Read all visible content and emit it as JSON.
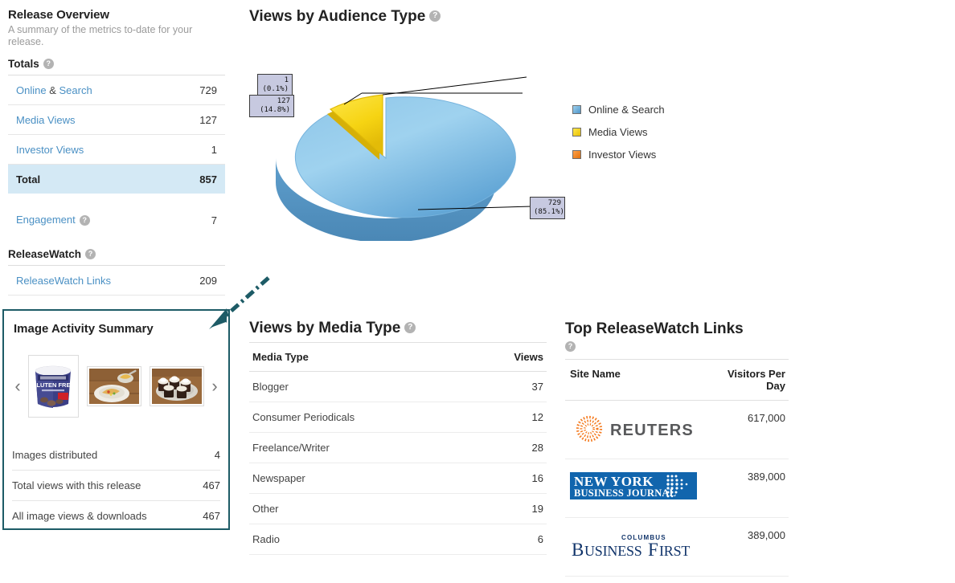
{
  "sidebar": {
    "title": "Release Overview",
    "subtitle": "A summary of the metrics to-date for your release.",
    "totals_label": "Totals",
    "help_glyph": "?",
    "rows": [
      {
        "label": "Online",
        "label2": "Search",
        "separator": "&",
        "value": "729"
      },
      {
        "label": "Media Views",
        "value": "127"
      },
      {
        "label": "Investor Views",
        "value": "1"
      },
      {
        "label": "Total",
        "value": "857"
      }
    ],
    "engagement": {
      "label": "Engagement",
      "value": "7"
    },
    "releasewatch_label": "ReleaseWatch",
    "releasewatch_links": {
      "label": "ReleaseWatch Links",
      "value": "209"
    }
  },
  "image_activity": {
    "title": "Image Activity Summary",
    "prev_glyph": "‹",
    "next_glyph": "›",
    "thumbnails": [
      {
        "name": "gluten-free-cookie-dough-tub"
      },
      {
        "name": "plated-food-on-wooden-table"
      },
      {
        "name": "chocolate-cupcakes-platter"
      }
    ],
    "rows": [
      {
        "label": "Images distributed",
        "value": "4"
      },
      {
        "label": "Total views with this release",
        "value": "467"
      },
      {
        "label": "All image views & downloads",
        "value": "467"
      }
    ]
  },
  "audience_chart": {
    "title": "Views by Audience Type",
    "legend_position": "right"
  },
  "chart_data": {
    "type": "pie",
    "title": "Views by Audience Type",
    "categories": [
      "Online & Search",
      "Media Views",
      "Investor Views"
    ],
    "values": [
      729,
      127,
      1
    ],
    "percentages": [
      "85.1%",
      "14.8%",
      "0.1%"
    ],
    "colors": [
      "#6aade0",
      "#f4d411",
      "#ee7c18"
    ],
    "labels": [
      {
        "text": "729\n(85.1%)",
        "series": "Online & Search"
      },
      {
        "text": "127\n(14.8%)",
        "series": "Media Views"
      },
      {
        "text": "1\n(0.1%)",
        "series": "Investor Views"
      }
    ],
    "legend": [
      "Online & Search",
      "Media Views",
      "Investor Views"
    ],
    "exploded_slice": "Media Views",
    "three_d": true
  },
  "media_type": {
    "title": "Views by Media Type",
    "columns": [
      "Media Type",
      "Views"
    ],
    "rows": [
      {
        "type": "Blogger",
        "views": "37"
      },
      {
        "type": "Consumer Periodicals",
        "views": "12"
      },
      {
        "type": "Freelance/Writer",
        "views": "28"
      },
      {
        "type": "Newspaper",
        "views": "16"
      },
      {
        "type": "Other",
        "views": "19"
      },
      {
        "type": "Radio",
        "views": "6"
      }
    ]
  },
  "releasewatch": {
    "title": "Top ReleaseWatch Links",
    "columns": [
      "Site Name",
      "Visitors Per Day"
    ],
    "rows": [
      {
        "site": "REUTERS",
        "logo": "reuters-logo",
        "visitors": "617,000"
      },
      {
        "site": "NEW YORK BUSINESS JOURNAL",
        "logo": "new-york-business-journal-logo",
        "visitors": "389,000"
      },
      {
        "site": "COLUMBUS BUSINESS FIRST",
        "logo": "columbus-business-first-logo",
        "visitors": "389,000"
      }
    ]
  },
  "annotation": {
    "arrow_color": "#1d5b66",
    "highlight_color": "#1d5b66"
  }
}
